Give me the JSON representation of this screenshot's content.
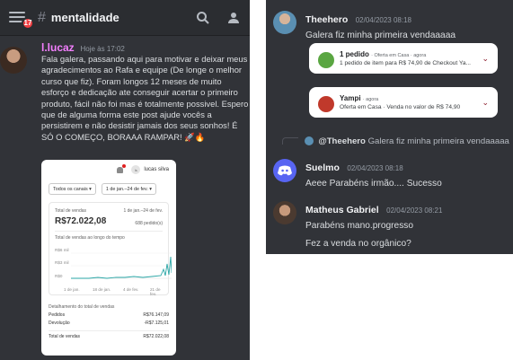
{
  "left": {
    "channel": "mentalidade",
    "badge": "17",
    "message": {
      "author": "l.lucaz",
      "time": "Hoje às 17:02",
      "author_color": "#f47fff",
      "text": "Fala galera, passando aqui para motivar e deixar meus agradecimentos ao Rafa e equipe (De longe o melhor curso que fiz). Foram longos 12 meses de muito esforço e dedicação ate conseguir acertar o primeiro produto, fácil não foi mas é totalmente possivel. Espero que de alguma forma este post ajude vocês a persistirem e não desistir jamais dos seus sonhos! É SÓ O COMEÇO, BORAAA RAMPAR! 🚀🔥"
    },
    "screenshot": {
      "user": "lucas silva",
      "filter_channels": "Todos os canais ▾",
      "filter_dates": "1 de jan.–24 de fev. ▾",
      "total_label": "Total de vendas",
      "total_range": "1 de jan.–24 de fev.",
      "total_value": "R$72.022,08",
      "orders": "688 pedido(s)",
      "chart_title": "Total de vendas ao longo do tempo",
      "y_ticks": [
        "R$6 mil",
        "R$3 mil",
        "R$0"
      ],
      "x_ticks": [
        "1 de jan.",
        "18 de jan.",
        "4 de fev.",
        "21 de fev."
      ],
      "detail_title": "Detalhamento do total de vendas",
      "details": [
        {
          "label": "Pedidos",
          "value": "R$76.147,09"
        },
        {
          "label": "Devolução",
          "value": "-R$7.125,01"
        },
        {
          "label": "Total de vendas",
          "value": "R$72.022,08"
        }
      ]
    }
  },
  "right": {
    "messages": [
      {
        "author": "Theehero",
        "time": "02/04/2023 08:18",
        "text": "Galera fiz minha primeira vendaaaaa"
      },
      {
        "author": "Suelmo",
        "time": "02/04/2023 08:18",
        "text": "Aeee Parabéns irmão.... Sucesso"
      },
      {
        "author": "Matheus Gabriel",
        "time": "02/04/2023 08:21",
        "text": "Parabéns mano.progresso",
        "text2": "Fez a venda no orgânico?"
      }
    ],
    "notifications": [
      {
        "title": "1 pedido",
        "meta": "· Oferta em Casa · agora",
        "body": "1 pedido de item para R$ 74,90 de Checkout Ya...",
        "icon_color": "#5aa642"
      },
      {
        "title": "Yampi",
        "meta": "· agora",
        "body": "Oferta em Casa · Venda no valor de R$ 74,90",
        "icon_color": "#c0392b"
      }
    ],
    "reply": {
      "author": "@Theehero",
      "text": "Galera fiz minha primeira vendaaaaa"
    }
  }
}
